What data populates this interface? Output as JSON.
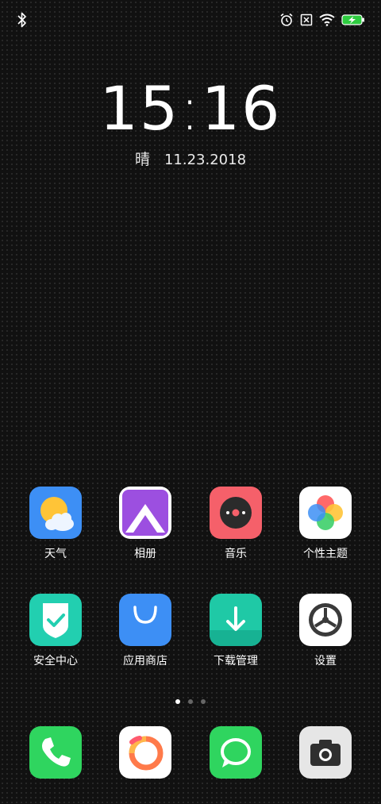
{
  "status_bar": {
    "left_icons": [
      "bluetooth-icon"
    ],
    "right_icons": [
      "alarm-icon",
      "no-sim-icon",
      "wifi-icon",
      "battery-charging-icon"
    ],
    "battery_color": "#2ecc40"
  },
  "lock_widget": {
    "hour": "15",
    "minute": "16",
    "weather": "晴",
    "date": "11.23.2018"
  },
  "home_row_1": [
    {
      "label": "天气",
      "icon": "weather-icon"
    },
    {
      "label": "相册",
      "icon": "gallery-icon"
    },
    {
      "label": "音乐",
      "icon": "music-icon"
    },
    {
      "label": "个性主题",
      "icon": "themes-icon"
    }
  ],
  "home_row_2": [
    {
      "label": "安全中心",
      "icon": "security-icon"
    },
    {
      "label": "应用商店",
      "icon": "app-store-icon"
    },
    {
      "label": "下载管理",
      "icon": "downloads-icon"
    },
    {
      "label": "设置",
      "icon": "settings-icon"
    }
  ],
  "page_indicator": {
    "pages": 3,
    "current": 1
  },
  "dock": [
    {
      "icon": "phone-icon"
    },
    {
      "icon": "browser-icon"
    },
    {
      "icon": "messages-icon"
    },
    {
      "icon": "camera-icon"
    }
  ],
  "colors": {
    "weather_bg": "#3d8ff5",
    "gallery_bg": "#9c4fe0",
    "music_bg": "#f5606a",
    "security_bg": "#22cfb0",
    "store_bg": "#3d8ff5",
    "download_bg": "#1fc9a6",
    "phone_bg": "#2fd55f",
    "messages_bg": "#2fd55f"
  }
}
